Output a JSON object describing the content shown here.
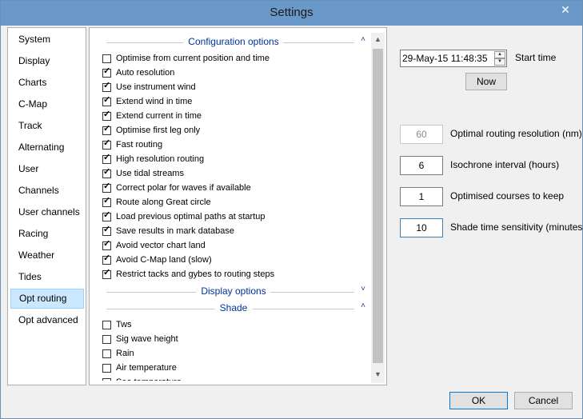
{
  "window": {
    "title": "Settings",
    "close_glyph": "✕"
  },
  "sidebar": {
    "items": [
      {
        "label": "System"
      },
      {
        "label": "Display"
      },
      {
        "label": "Charts"
      },
      {
        "label": "C-Map"
      },
      {
        "label": "Track"
      },
      {
        "label": "Alternating"
      },
      {
        "label": "User"
      },
      {
        "label": "Channels"
      },
      {
        "label": "User channels"
      },
      {
        "label": "Racing"
      },
      {
        "label": "Weather"
      },
      {
        "label": "Tides"
      },
      {
        "label": "Opt routing",
        "selected": true
      },
      {
        "label": "Opt advanced"
      }
    ]
  },
  "options": {
    "config_header": "Configuration options",
    "config_items": [
      {
        "label": "Optimise from current position and time",
        "checked": false
      },
      {
        "label": "Auto resolution",
        "checked": true
      },
      {
        "label": "Use instrument wind",
        "checked": true
      },
      {
        "label": "Extend wind in time",
        "checked": true
      },
      {
        "label": "Extend current in time",
        "checked": true
      },
      {
        "label": "Optimise first leg only",
        "checked": true
      },
      {
        "label": "Fast routing",
        "checked": true
      },
      {
        "label": "High resolution routing",
        "checked": true
      },
      {
        "label": "Use tidal streams",
        "checked": true
      },
      {
        "label": "Correct polar for waves if available",
        "checked": true
      },
      {
        "label": "Route along Great circle",
        "checked": true
      },
      {
        "label": "Load previous optimal paths at startup",
        "checked": true
      },
      {
        "label": "Save results in mark database",
        "checked": true
      },
      {
        "label": "Avoid vector chart land",
        "checked": true
      },
      {
        "label": "Avoid C-Map land (slow)",
        "checked": true
      },
      {
        "label": "Restrict tacks and gybes to routing steps",
        "checked": true
      }
    ],
    "display_header": "Display options",
    "shade_header": "Shade",
    "shade_items": [
      {
        "label": "Tws",
        "checked": false
      },
      {
        "label": "Sig wave height",
        "checked": false
      },
      {
        "label": "Rain",
        "checked": false
      },
      {
        "label": "Air temperature",
        "checked": false
      },
      {
        "label": "Sea temperature",
        "checked": false
      }
    ],
    "chevron_up": "˄",
    "chevron_down": "˅"
  },
  "start": {
    "datetime": "29-May-15 11:48:35",
    "label": "Start time",
    "now_button": "Now"
  },
  "fields": [
    {
      "value": "60",
      "label": "Optimal routing resolution (nm)",
      "disabled": true
    },
    {
      "value": "6",
      "label": "Isochrone interval (hours)"
    },
    {
      "value": "1",
      "label": "Optimised courses to keep"
    },
    {
      "value": "10",
      "label": "Shade time sensitivity (minutes)",
      "focused": true
    }
  ],
  "buttons": {
    "ok": "OK",
    "cancel": "Cancel"
  }
}
